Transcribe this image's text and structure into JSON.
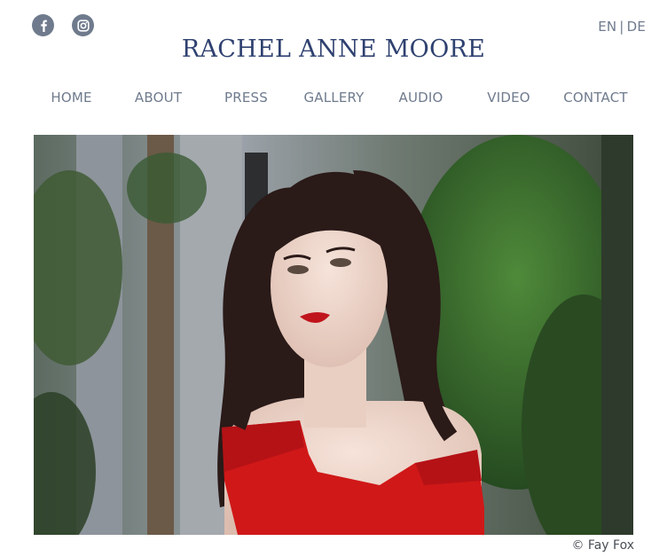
{
  "social": {
    "facebook_icon": "facebook-icon",
    "instagram_icon": "instagram-icon"
  },
  "language": {
    "en": "EN",
    "separator": "|",
    "de": "DE"
  },
  "site_title": "RACHEL ANNE MOORE",
  "nav": [
    {
      "label": "HOME"
    },
    {
      "label": "ABOUT"
    },
    {
      "label": "PRESS"
    },
    {
      "label": "GALLERY"
    },
    {
      "label": "AUDIO"
    },
    {
      "label": "VIDEO"
    },
    {
      "label": "CONTACT"
    }
  ],
  "hero": {
    "credit": "© Fay Fox"
  },
  "colors": {
    "title": "#2f4170",
    "nav": "#6f7b8d",
    "icon_bg": "#6f7b8d",
    "dress": "#d01818"
  }
}
